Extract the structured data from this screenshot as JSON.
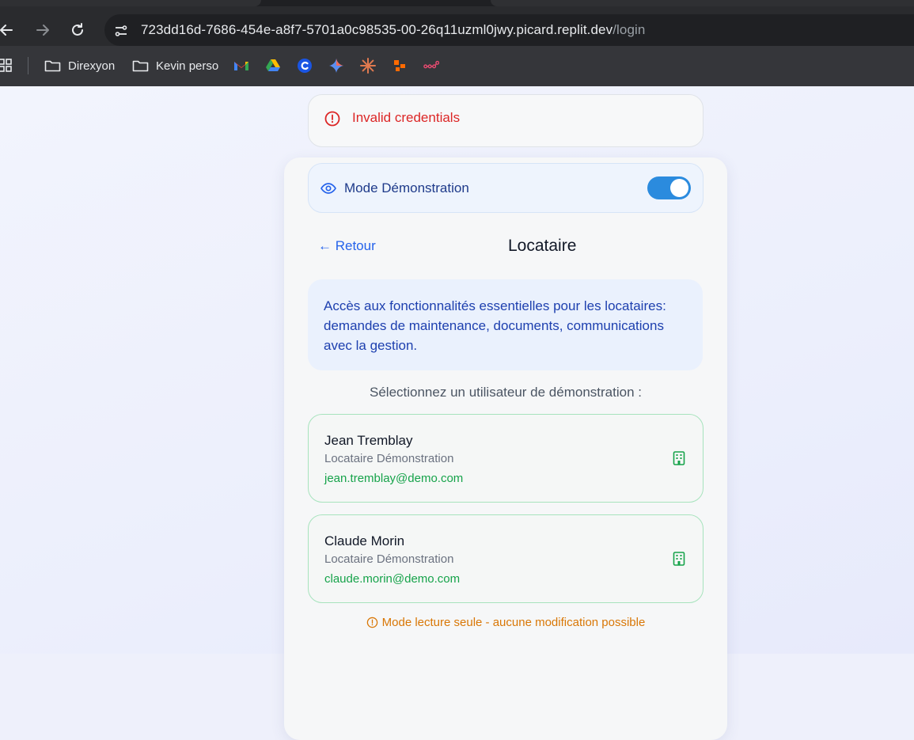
{
  "browser": {
    "url_host": "723dd16d-7686-454e-a8f7-5701a0c98535-00-26q11uzml0jwy.picard.replit.dev",
    "url_path": "/login",
    "bookmarks": [
      {
        "label": "Direxyon",
        "icon": "folder-icon"
      },
      {
        "label": "Kevin perso",
        "icon": "folder-icon"
      }
    ],
    "bookmark_icons": [
      "gmail-icon",
      "google-drive-icon",
      "c-icon",
      "gemini-icon",
      "claude-icon",
      "zapier-icon",
      "n8n-icon"
    ]
  },
  "alert": {
    "text": "Invalid credentials",
    "color": "#dc2626"
  },
  "demo_mode": {
    "label": "Mode Démonstration",
    "enabled": true,
    "accent": "#2b8bde"
  },
  "header": {
    "back_label": "← Retour",
    "title": "Locataire"
  },
  "info": {
    "text": "Accès aux fonctionnalités essentielles pour les locataires: demandes de maintenance, documents, communications avec la gestion."
  },
  "prompt": "Sélectionnez un utilisateur de démonstration :",
  "users": [
    {
      "name": "Jean Tremblay",
      "role": "Locataire Démonstration",
      "email": "jean.tremblay@demo.com"
    },
    {
      "name": "Claude Morin",
      "role": "Locataire Démonstration",
      "email": "claude.morin@demo.com"
    }
  ],
  "footer_notice": "Mode lecture seule - aucune modification possible"
}
